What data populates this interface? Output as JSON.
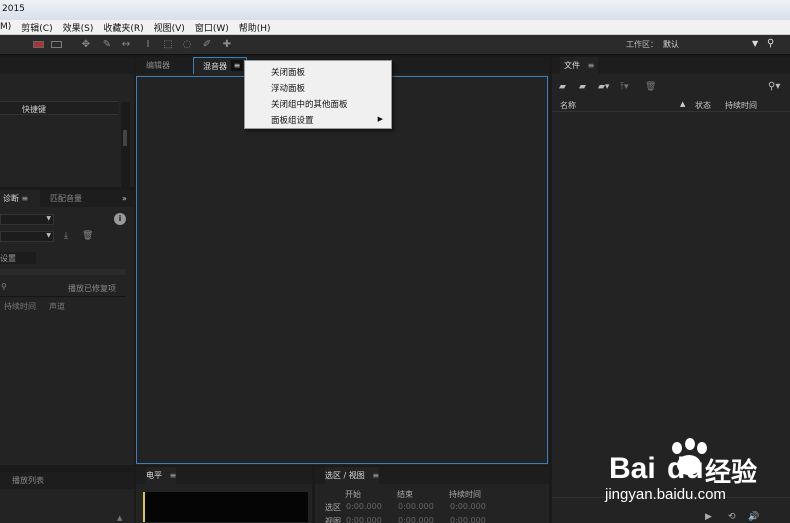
{
  "app": {
    "title_fragment": "2015"
  },
  "menubar": {
    "items": [
      "M)",
      "剪辑(C)",
      "效果(S)",
      "收藏夹(R)",
      "视图(V)",
      "窗口(W)",
      "帮助(H)"
    ]
  },
  "toolbar": {
    "workspace_label": "工作区：",
    "workspace_value": "默认"
  },
  "left_panel": {
    "shortcut_header": "快捷键",
    "diag_tab": "诊断",
    "match_tab": "匹配音量",
    "settings_label": "设置",
    "repair_button": "播放已修复项",
    "col_duration": "持续时间",
    "col_channel": "声道",
    "playlist_tab": "播放列表"
  },
  "center": {
    "tab_editor": "编辑器",
    "tab_mixer": "混音器",
    "level_tab": "电平"
  },
  "context_menu": {
    "items": [
      "关闭面板",
      "浮动面板",
      "关闭组中的其他面板",
      "面板组设置"
    ]
  },
  "files_panel": {
    "tab": "文件",
    "col_name": "名称",
    "col_status": "状态",
    "col_duration": "持续时间"
  },
  "selection_panel": {
    "tab": "选区 / 视图",
    "col_start": "开始",
    "col_end": "结束",
    "col_duration": "持续时间",
    "row_selection": "选区",
    "row_view": "视图",
    "start": "0:00.000",
    "end": "0:00.000",
    "duration": "0:00.000"
  },
  "watermark": {
    "brand": "Bai",
    "brand2": "du",
    "brand_cn": "经验",
    "url": "jingyan.baidu.com"
  }
}
